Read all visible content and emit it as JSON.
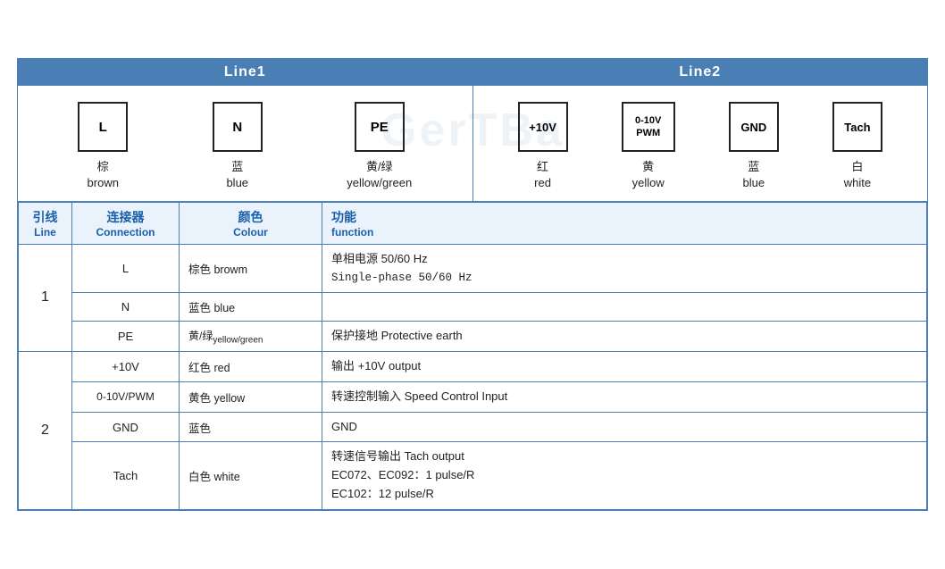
{
  "lines": {
    "line1": {
      "label": "Line1",
      "connectors": [
        {
          "symbol": "L",
          "zh": "棕",
          "en": "brown"
        },
        {
          "symbol": "N",
          "zh": "蓝",
          "en": "blue"
        },
        {
          "symbol": "PE",
          "zh": "黄/绿",
          "en": "yellow/green"
        }
      ]
    },
    "line2": {
      "label": "Line2",
      "connectors": [
        {
          "symbol": "+10V",
          "zh": "红",
          "en": "red"
        },
        {
          "symbol": "0-10V\nPWM",
          "zh": "黄",
          "en": "yellow"
        },
        {
          "symbol": "GND",
          "zh": "蓝",
          "en": "blue"
        },
        {
          "symbol": "Tach",
          "zh": "白",
          "en": "white"
        }
      ]
    }
  },
  "table": {
    "headers": {
      "line_zh": "引线",
      "line_en": "Line",
      "conn_zh": "连接器",
      "conn_en": "Connection",
      "color_zh": "颜色",
      "color_en": "Colour",
      "func_zh": "功能",
      "func_en": "function"
    },
    "rows": [
      {
        "line": "1",
        "rowspan": 3,
        "entries": [
          {
            "conn": "L",
            "color": "棕色 browm",
            "func": "单相电源 50/60 Hz\nSingle-phase 50/60 Hz"
          },
          {
            "conn": "N",
            "color": "蓝色 blue",
            "func": ""
          },
          {
            "conn": "PE",
            "color": "黄/绿yellow/green",
            "func": "保护接地 Protective earth"
          }
        ]
      },
      {
        "line": "2",
        "rowspan": 4,
        "entries": [
          {
            "conn": "+10V",
            "color": "红色 red",
            "func": "输出 +10V output"
          },
          {
            "conn": "0-10V/PWM",
            "color": "黄色 yellow",
            "func": "转速控制输入 Speed Control Input"
          },
          {
            "conn": "GND",
            "color": "蓝色",
            "func": "GND"
          },
          {
            "conn": "Tach",
            "color": "白色 white",
            "func": "转速信号输出 Tach output\nEC072、EC092：1 pulse/R\nEC102：12 pulse/R"
          }
        ]
      }
    ]
  },
  "watermark": "GerTBa"
}
